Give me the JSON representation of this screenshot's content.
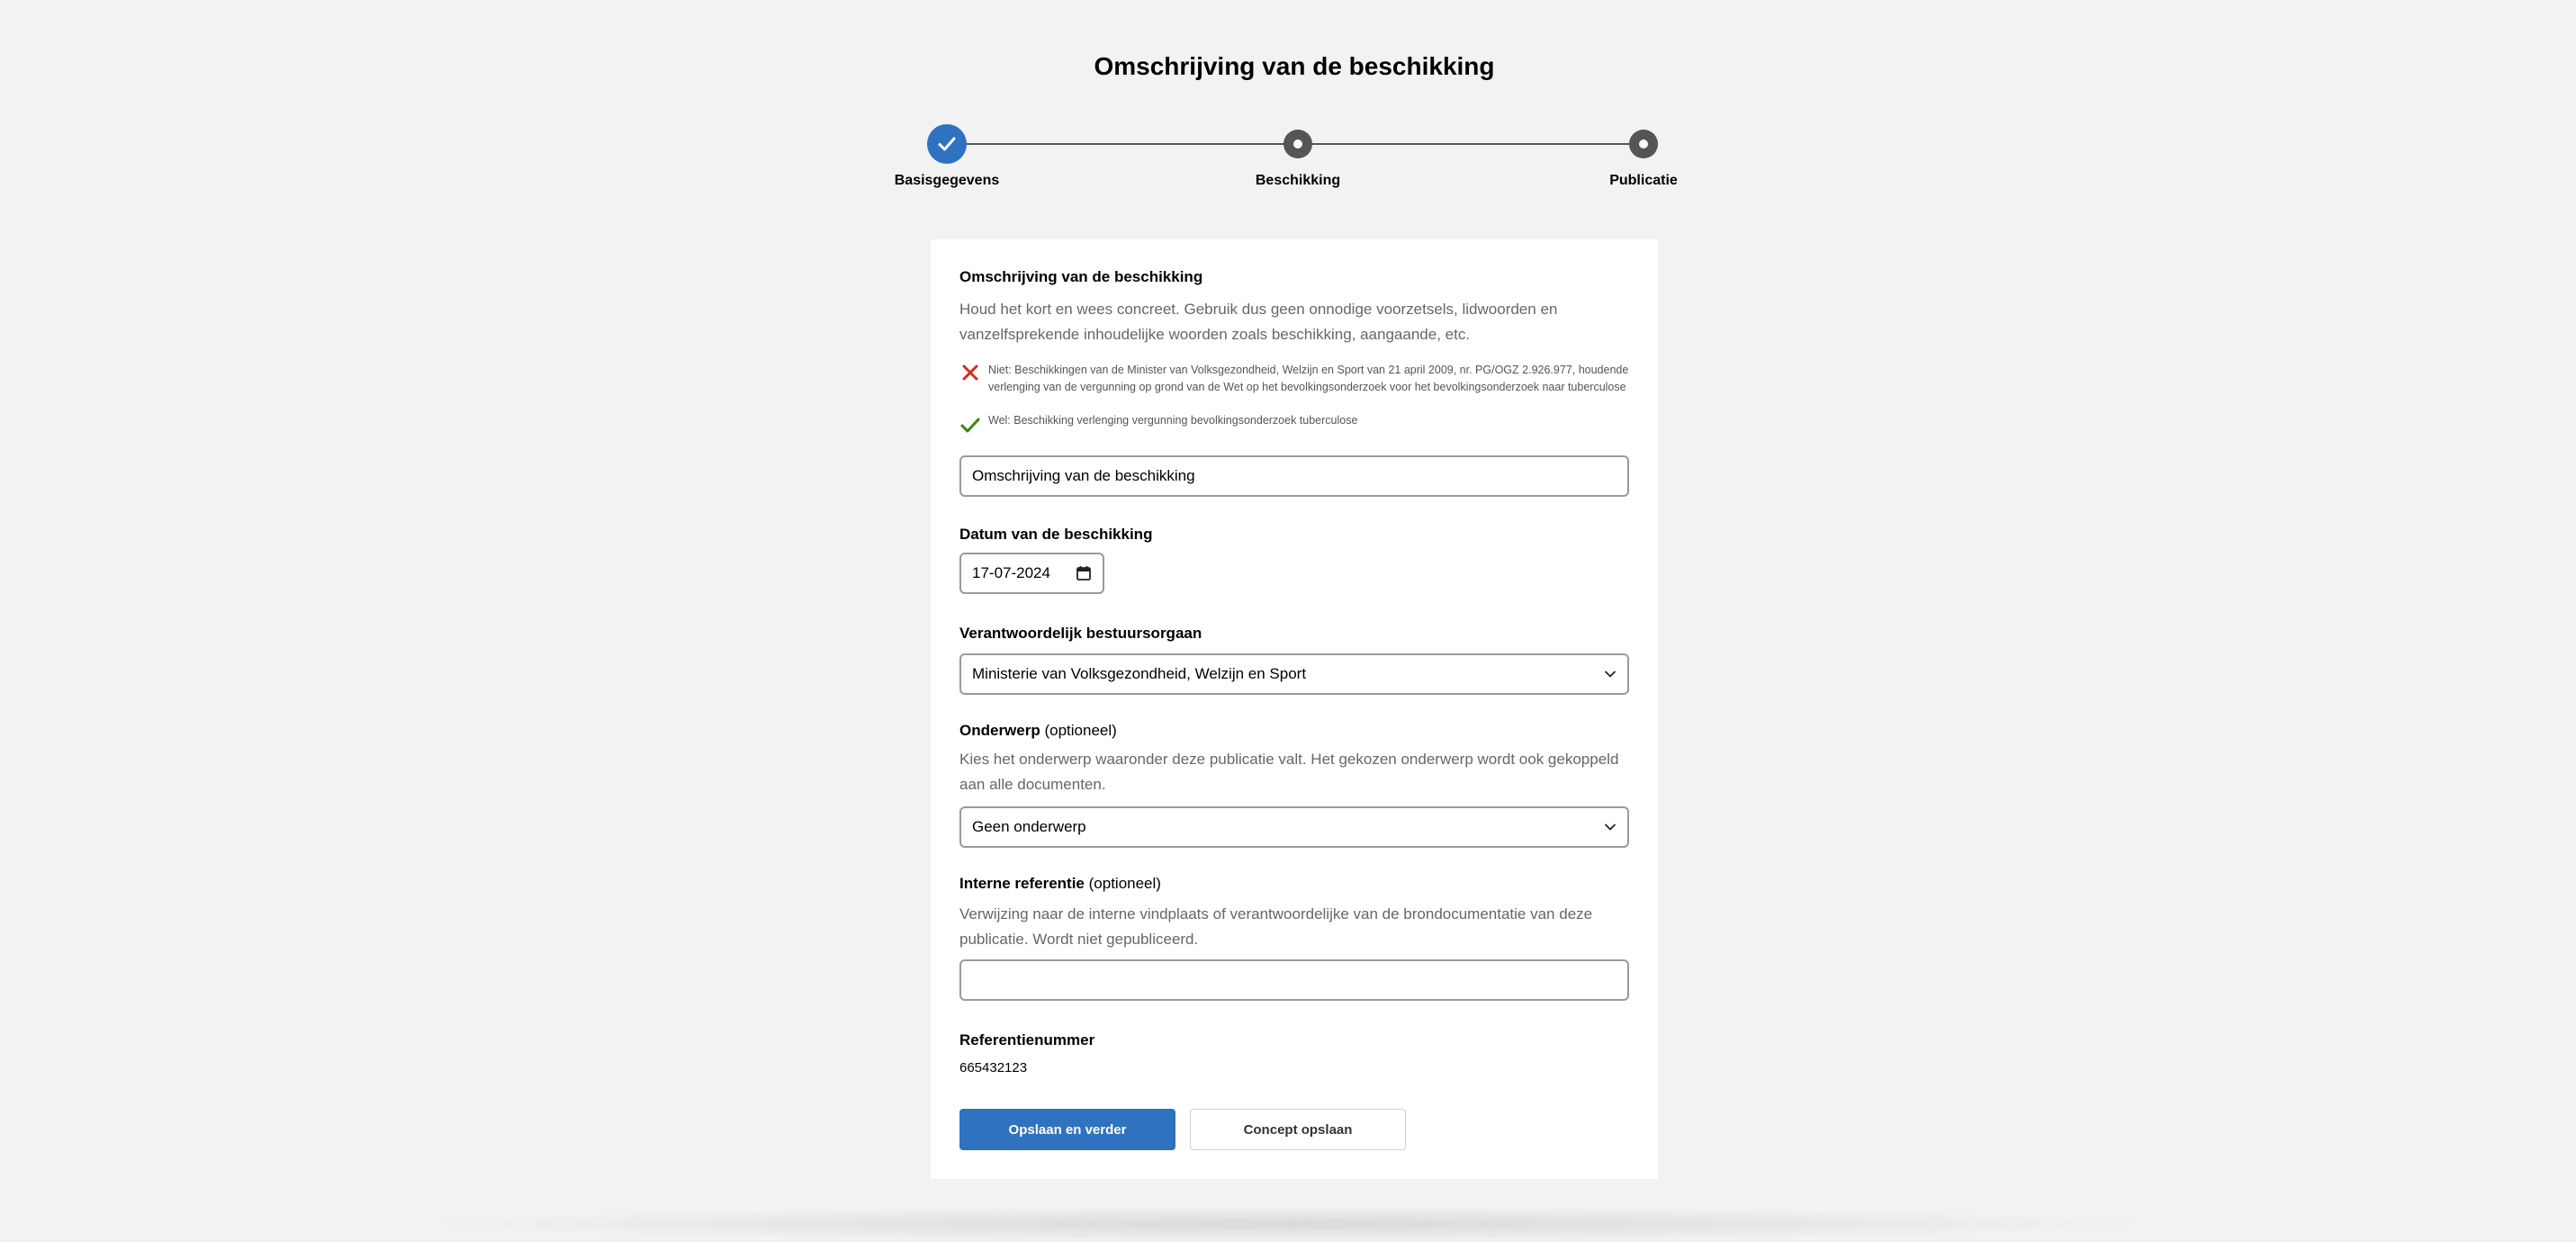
{
  "page": {
    "title": "Omschrijving van de beschikking"
  },
  "stepper": {
    "steps": [
      {
        "label": "Basisgegevens",
        "state": "completed"
      },
      {
        "label": "Beschikking",
        "state": "pending"
      },
      {
        "label": "Publicatie",
        "state": "pending"
      }
    ]
  },
  "form": {
    "description": {
      "label": "Omschrijving van de beschikking",
      "help": "Houd het kort en wees concreet. Gebruik dus geen onnodige voorzetsels, lidwoorden en vanzelfsprekende inhoudelijke woorden zoals beschikking, aangaande, etc.",
      "example_bad": "Niet: Beschikkingen van de Minister van Volksgezondheid, Welzijn en Sport van 21 april 2009, nr. PG/OGZ 2.926.977, houdende verlenging van de vergunning op grond van de Wet op het bevolkingsonderzoek voor het bevolkingsonderzoek naar tuberculose",
      "example_good": "Wel: Beschikking verlenging vergunning bevolkingsonderzoek tuberculose",
      "value": "Omschrijving van de beschikking"
    },
    "date": {
      "label": "Datum van de beschikking",
      "value": "17-07-2024"
    },
    "authority": {
      "label": "Verantwoordelijk bestuursorgaan",
      "value": "Ministerie van Volksgezondheid, Welzijn en Sport"
    },
    "subject": {
      "label": "Onderwerp",
      "optional": "(optioneel)",
      "help": "Kies het onderwerp waaronder deze publicatie valt. Het gekozen onderwerp wordt ook gekoppeld aan alle documenten.",
      "value": "Geen onderwerp"
    },
    "internal_reference": {
      "label": "Interne referentie",
      "optional": "(optioneel)",
      "help": "Verwijzing naar de interne vindplaats of verantwoordelijke van de brondocumentatie van deze publicatie. Wordt niet gepubliceerd.",
      "value": ""
    },
    "reference_number": {
      "label": "Referentienummer",
      "value": "665432123"
    }
  },
  "actions": {
    "save_next": "Opslaan en verder",
    "save_draft": "Concept opslaan"
  },
  "colors": {
    "primary": "#2f72c0",
    "error": "#d52b1e",
    "success": "#39870c"
  }
}
